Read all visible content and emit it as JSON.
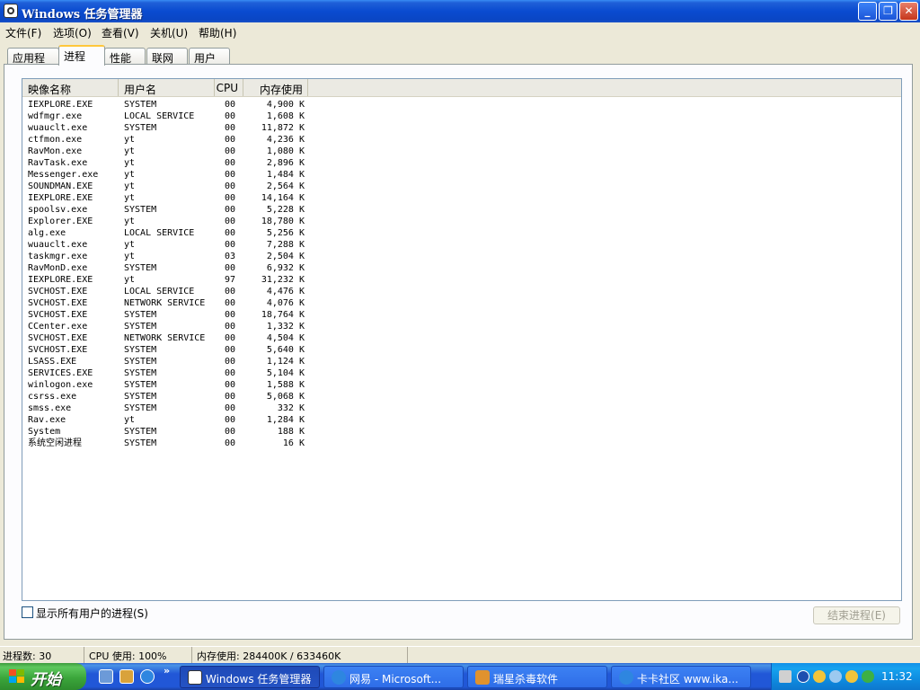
{
  "window": {
    "title": "Windows 任务管理器"
  },
  "title_buttons": {
    "minimize": "_",
    "maximize": "❐",
    "close": "✕"
  },
  "menu": [
    "文件(F)",
    "选项(O)",
    "查看(V)",
    "关机(U)",
    "帮助(H)"
  ],
  "tabs": [
    "应用程序",
    "进程",
    "性能",
    "联网",
    "用户"
  ],
  "active_tab": "进程",
  "columns": {
    "name": "映像名称",
    "user": "用户名",
    "cpu": "CPU",
    "mem": "内存使用"
  },
  "processes": [
    {
      "name": "IEXPLORE.EXE",
      "user": "SYSTEM",
      "cpu": "00",
      "mem": "4,900 K"
    },
    {
      "name": "wdfmgr.exe",
      "user": "LOCAL SERVICE",
      "cpu": "00",
      "mem": "1,608 K"
    },
    {
      "name": "wuauclt.exe",
      "user": "SYSTEM",
      "cpu": "00",
      "mem": "11,872 K"
    },
    {
      "name": "ctfmon.exe",
      "user": "yt",
      "cpu": "00",
      "mem": "4,236 K"
    },
    {
      "name": "RavMon.exe",
      "user": "yt",
      "cpu": "00",
      "mem": "1,080 K"
    },
    {
      "name": "RavTask.exe",
      "user": "yt",
      "cpu": "00",
      "mem": "2,896 K"
    },
    {
      "name": "Messenger.exe",
      "user": "yt",
      "cpu": "00",
      "mem": "1,484 K"
    },
    {
      "name": "SOUNDMAN.EXE",
      "user": "yt",
      "cpu": "00",
      "mem": "2,564 K"
    },
    {
      "name": "IEXPLORE.EXE",
      "user": "yt",
      "cpu": "00",
      "mem": "14,164 K"
    },
    {
      "name": "spoolsv.exe",
      "user": "SYSTEM",
      "cpu": "00",
      "mem": "5,228 K"
    },
    {
      "name": "Explorer.EXE",
      "user": "yt",
      "cpu": "00",
      "mem": "18,780 K"
    },
    {
      "name": "alg.exe",
      "user": "LOCAL SERVICE",
      "cpu": "00",
      "mem": "5,256 K"
    },
    {
      "name": "wuauclt.exe",
      "user": "yt",
      "cpu": "00",
      "mem": "7,288 K"
    },
    {
      "name": "taskmgr.exe",
      "user": "yt",
      "cpu": "03",
      "mem": "2,504 K"
    },
    {
      "name": "RavMonD.exe",
      "user": "SYSTEM",
      "cpu": "00",
      "mem": "6,932 K"
    },
    {
      "name": "IEXPLORE.EXE",
      "user": "yt",
      "cpu": "97",
      "mem": "31,232 K"
    },
    {
      "name": "SVCHOST.EXE",
      "user": "LOCAL SERVICE",
      "cpu": "00",
      "mem": "4,476 K"
    },
    {
      "name": "SVCHOST.EXE",
      "user": "NETWORK SERVICE",
      "cpu": "00",
      "mem": "4,076 K"
    },
    {
      "name": "SVCHOST.EXE",
      "user": "SYSTEM",
      "cpu": "00",
      "mem": "18,764 K"
    },
    {
      "name": "CCenter.exe",
      "user": "SYSTEM",
      "cpu": "00",
      "mem": "1,332 K"
    },
    {
      "name": "SVCHOST.EXE",
      "user": "NETWORK SERVICE",
      "cpu": "00",
      "mem": "4,504 K"
    },
    {
      "name": "SVCHOST.EXE",
      "user": "SYSTEM",
      "cpu": "00",
      "mem": "5,640 K"
    },
    {
      "name": "LSASS.EXE",
      "user": "SYSTEM",
      "cpu": "00",
      "mem": "1,124 K"
    },
    {
      "name": "SERVICES.EXE",
      "user": "SYSTEM",
      "cpu": "00",
      "mem": "5,104 K"
    },
    {
      "name": "winlogon.exe",
      "user": "SYSTEM",
      "cpu": "00",
      "mem": "1,588 K"
    },
    {
      "name": "csrss.exe",
      "user": "SYSTEM",
      "cpu": "00",
      "mem": "5,068 K"
    },
    {
      "name": "smss.exe",
      "user": "SYSTEM",
      "cpu": "00",
      "mem": "332 K"
    },
    {
      "name": "Rav.exe",
      "user": "yt",
      "cpu": "00",
      "mem": "1,284 K"
    },
    {
      "name": "System",
      "user": "SYSTEM",
      "cpu": "00",
      "mem": "188 K"
    },
    {
      "name": "系统空闲进程",
      "user": "SYSTEM",
      "cpu": "00",
      "mem": "16 K"
    }
  ],
  "show_all_label": "显示所有用户的进程(S)",
  "end_process_label": "结束进程(E)",
  "status": {
    "process_count": "进程数: 30",
    "cpu_usage": "CPU 使用: 100%",
    "memory_usage": "内存使用: 284400K / 633460K"
  },
  "taskbar": {
    "start_label": "开始",
    "quick_launch_more": "»",
    "tasks": [
      {
        "label": "Windows 任务管理器",
        "icon": "task-manager-icon"
      },
      {
        "label": "网易 - Microsoft...",
        "icon": "ie-icon"
      },
      {
        "label": "瑞星杀毒软件",
        "icon": "rising-antivirus-icon"
      },
      {
        "label": "卡卡社区 www.ika...",
        "icon": "ie-icon"
      }
    ],
    "clock": "11:32"
  },
  "colors": {
    "titlebar": "#0A4BD0",
    "taskbar": "#2157D7",
    "start": "#3BA63B",
    "tray": "#0F8CE0",
    "dialog": "#ECE9D8"
  }
}
